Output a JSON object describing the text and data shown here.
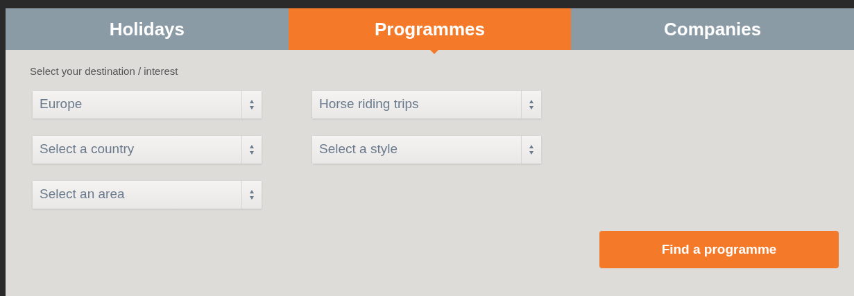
{
  "tabs": [
    {
      "label": "Holidays",
      "selected": false
    },
    {
      "label": "Programmes",
      "selected": true
    },
    {
      "label": "Companies",
      "selected": false
    }
  ],
  "form": {
    "label": "Select your destination / interest",
    "columns": [
      [
        {
          "value": "Europe"
        },
        {
          "value": "Select a country"
        },
        {
          "value": "Select an area"
        }
      ],
      [
        {
          "value": "Horse riding trips"
        },
        {
          "value": "Select a style"
        }
      ]
    ],
    "submit": "Find a programme"
  }
}
